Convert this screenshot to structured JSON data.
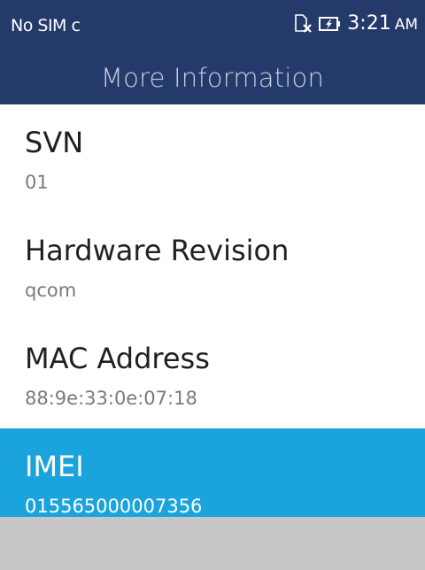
{
  "status_bar": {
    "carrier": "No SIM c",
    "time": "3:21",
    "ampm": "AM",
    "icons": [
      "no-sim-icon",
      "battery-charging-icon"
    ]
  },
  "header": {
    "title": "More Information"
  },
  "items": [
    {
      "label": "SVN",
      "value": "01"
    },
    {
      "label": "Hardware Revision",
      "value": "qcom"
    },
    {
      "label": "MAC Address",
      "value": "88:9e:33:0e:07:18"
    },
    {
      "label": "IMEI",
      "value": "015565000007356"
    }
  ],
  "selected_index": 3,
  "colors": {
    "header_bg": "#243a6b",
    "selected_bg": "#1ba4dc",
    "softkey_bg": "#c7c7c7"
  }
}
